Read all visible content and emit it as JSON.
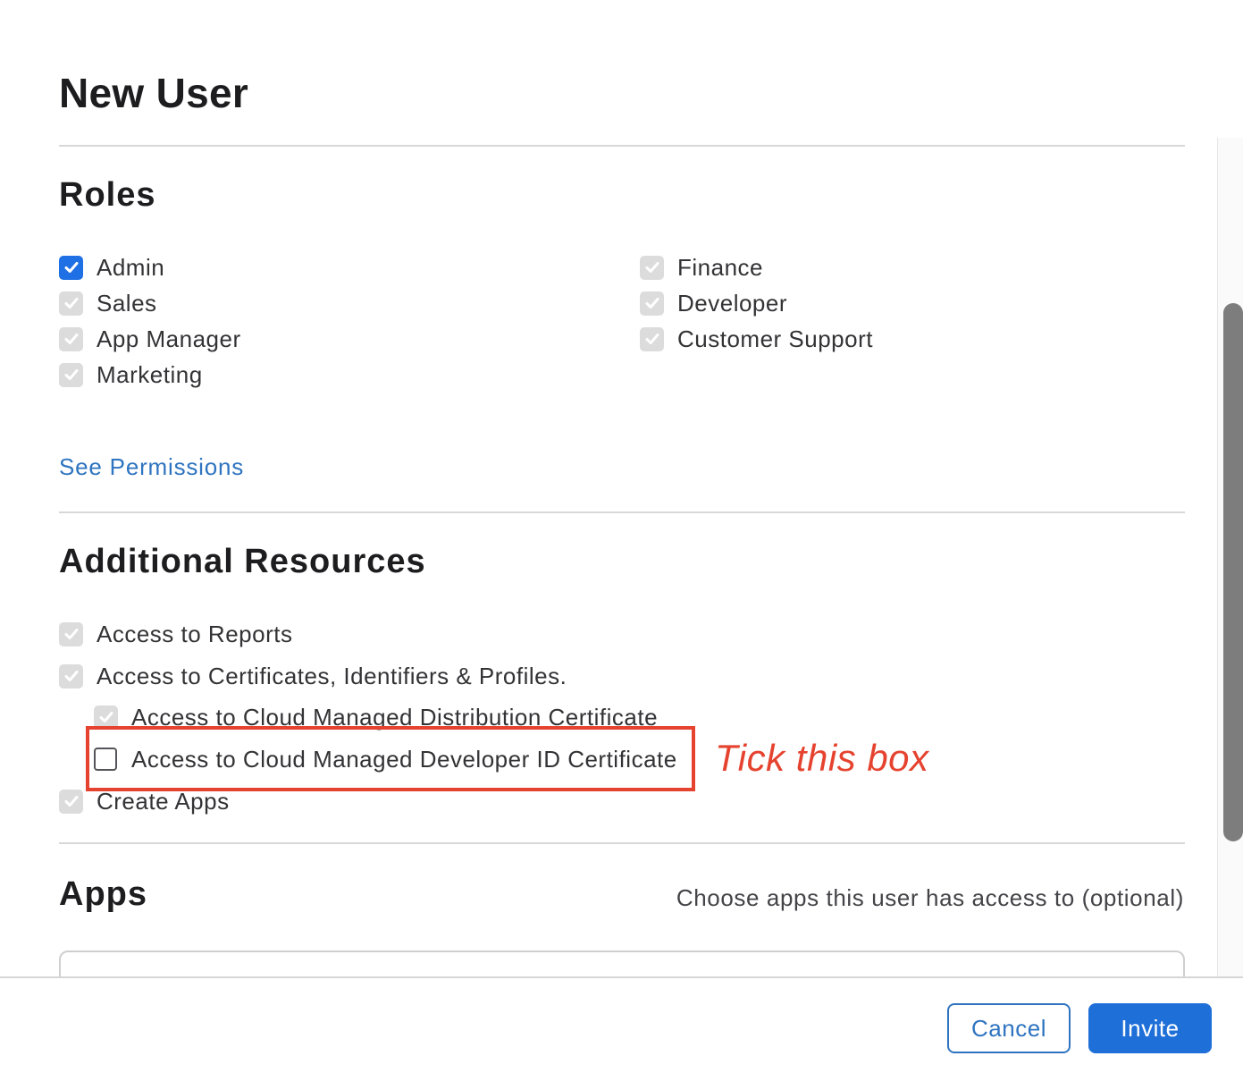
{
  "dialog": {
    "title": "New User"
  },
  "roles": {
    "heading": "Roles",
    "left_items": [
      {
        "label": "Admin",
        "state": "checked"
      },
      {
        "label": "Sales",
        "state": "checked-disabled"
      },
      {
        "label": "App Manager",
        "state": "checked-disabled"
      },
      {
        "label": "Marketing",
        "state": "checked-disabled"
      }
    ],
    "right_items": [
      {
        "label": "Finance",
        "state": "checked-disabled"
      },
      {
        "label": "Developer",
        "state": "checked-disabled"
      },
      {
        "label": "Customer Support",
        "state": "checked-disabled"
      }
    ],
    "see_permissions_link": "See Permissions"
  },
  "additional_resources": {
    "heading": "Additional Resources",
    "items": [
      {
        "label": "Access to Reports",
        "state": "checked-disabled"
      },
      {
        "label": "Access to Certificates, Identifiers & Profiles.",
        "state": "checked-disabled"
      },
      {
        "label": "Access to Cloud Managed Distribution Certificate",
        "state": "checked-disabled"
      },
      {
        "label": "Access to Cloud Managed Developer ID Certificate",
        "state": "unchecked"
      },
      {
        "label": "Create Apps",
        "state": "checked-disabled"
      }
    ]
  },
  "apps": {
    "heading": "Apps",
    "hint": "Choose apps this user has access to (optional)"
  },
  "footer": {
    "cancel_label": "Cancel",
    "invite_label": "Invite"
  },
  "annotation": {
    "text": "Tick this box",
    "color": "#e5432f"
  },
  "colors": {
    "accent": "#1f6fe5",
    "link": "#2f74c0",
    "disabled_check": "#dcdcdc"
  },
  "icons": {
    "checkmark": "checkmark-icon"
  }
}
